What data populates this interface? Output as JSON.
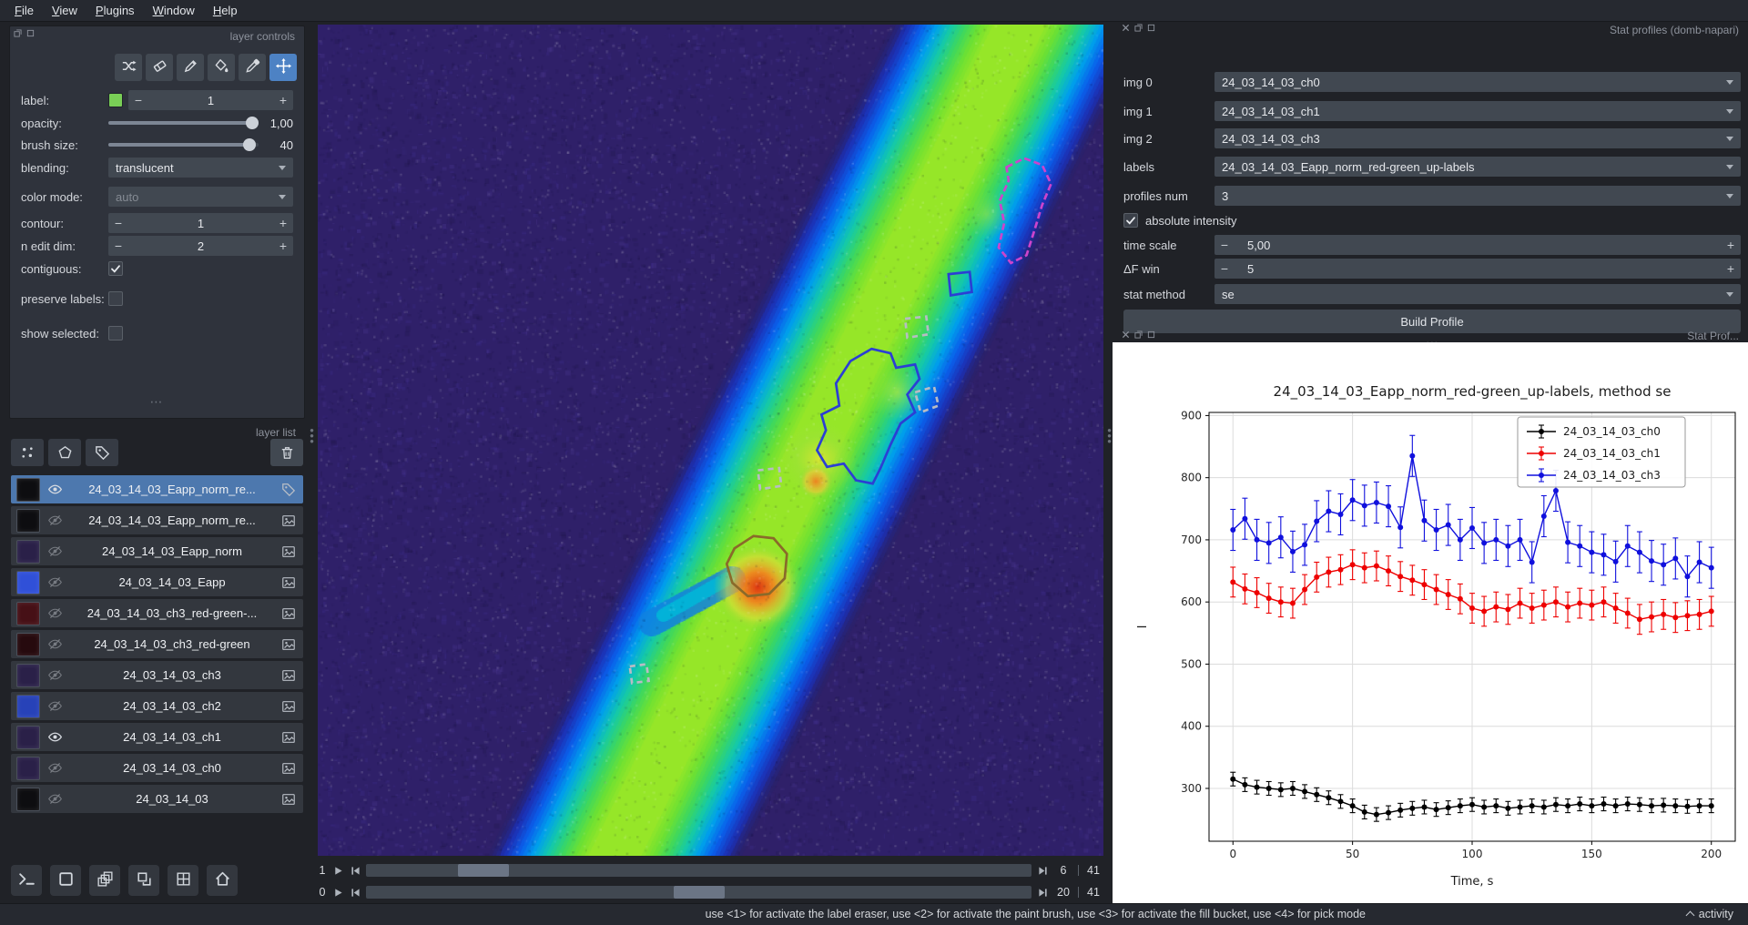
{
  "menu": {
    "items": [
      "File",
      "View",
      "Plugins",
      "Window",
      "Help"
    ]
  },
  "ui": {
    "minus": "−",
    "plus": "+",
    "dots": "⋯"
  },
  "layer_controls": {
    "title": "layer controls",
    "tools": [
      "shuffle-colors",
      "label-eraser",
      "paint-brush",
      "fill-bucket",
      "color-picker",
      "pan-zoom"
    ],
    "active_tool": "pan-zoom",
    "rows": {
      "label": {
        "label": "label:",
        "value": "1",
        "swatch_color": "#79cf56"
      },
      "opacity": {
        "label": "opacity:",
        "value": "1,00"
      },
      "brush_size": {
        "label": "brush size:",
        "value": "40"
      },
      "blending": {
        "label": "blending:",
        "value": "translucent"
      },
      "color_mode": {
        "label": "color mode:",
        "value": "auto",
        "disabled": true
      },
      "contour": {
        "label": "contour:",
        "value": "1"
      },
      "n_edit_dim": {
        "label": "n edit dim:",
        "value": "2"
      },
      "contiguous": {
        "label": "contiguous:",
        "checked": true
      },
      "preserve_labels": {
        "label": "preserve labels:",
        "checked": false
      },
      "show_selected": {
        "label": "show selected:",
        "checked": false
      }
    }
  },
  "layer_list": {
    "title": "layer list",
    "buttons": [
      "new-points-layer",
      "new-shapes-layer",
      "new-labels-layer"
    ],
    "delete_button": "delete-layer",
    "layers": [
      {
        "name": "24_03_14_03_Eapp_norm_re...",
        "visible": true,
        "selected": true,
        "type": "labels",
        "thumb": "#0d0d10"
      },
      {
        "name": "24_03_14_03_Eapp_norm_re...",
        "visible": false,
        "selected": false,
        "type": "image",
        "thumb": "#0d0d10"
      },
      {
        "name": "24_03_14_03_Eapp_norm",
        "visible": false,
        "selected": false,
        "type": "image",
        "thumb": "#2a2048"
      },
      {
        "name": "24_03_14_03_Eapp",
        "visible": false,
        "selected": false,
        "type": "image",
        "thumb": "#3050d8"
      },
      {
        "name": "24_03_14_03_ch3_red-green-...",
        "visible": false,
        "selected": false,
        "type": "image",
        "thumb": "#461016"
      },
      {
        "name": "24_03_14_03_ch3_red-green",
        "visible": false,
        "selected": false,
        "type": "image",
        "thumb": "#260a0e"
      },
      {
        "name": "24_03_14_03_ch3",
        "visible": false,
        "selected": false,
        "type": "image",
        "thumb": "#2a2048"
      },
      {
        "name": "24_03_14_03_ch2",
        "visible": false,
        "selected": false,
        "type": "image",
        "thumb": "#2742b8"
      },
      {
        "name": "24_03_14_03_ch1",
        "visible": true,
        "selected": false,
        "type": "image",
        "thumb": "#2a2048"
      },
      {
        "name": "24_03_14_03_ch0",
        "visible": false,
        "selected": false,
        "type": "image",
        "thumb": "#2a2048"
      },
      {
        "name": "24_03_14_03",
        "visible": false,
        "selected": false,
        "type": "image",
        "thumb": "#0d0d10"
      }
    ]
  },
  "viewer_buttons": [
    "console",
    "toggle-2d-3d",
    "roll-dimensions",
    "transpose-dimensions",
    "grid-view",
    "reset-view"
  ],
  "dims": [
    {
      "label": "1",
      "current": "6",
      "total": "41",
      "frac": 0.15
    },
    {
      "label": "0",
      "current": "20",
      "total": "41",
      "frac": 0.5
    }
  ],
  "stat_panel": {
    "title": "Stat profiles (domb-napari)",
    "img0": {
      "label": "img 0",
      "value": "24_03_14_03_ch0"
    },
    "img1": {
      "label": "img 1",
      "value": "24_03_14_03_ch1"
    },
    "img2": {
      "label": "img 2",
      "value": "24_03_14_03_ch3"
    },
    "labels": {
      "label": "labels",
      "value": "24_03_14_03_Eapp_norm_red-green_up-labels"
    },
    "profiles_num": {
      "label": "profiles num",
      "value": "3"
    },
    "absolute_intensity": {
      "label": "absolute intensity",
      "checked": true
    },
    "time_scale": {
      "label": "time scale",
      "value": "5,00"
    },
    "df_win": {
      "label": "ΔF win",
      "value": "5"
    },
    "stat_method": {
      "label": "stat method",
      "value": "se"
    },
    "build_button": "Build Profile"
  },
  "plot_panel": {
    "title": "Stat Prof..."
  },
  "chart_data": {
    "type": "line",
    "title": "24_03_14_03_Eapp_norm_red-green_up-labels, method se",
    "xlabel": "Time, s",
    "ylabel": "I",
    "xlim": [
      -10,
      210
    ],
    "ylim": [
      215,
      905
    ],
    "xticks": [
      0,
      50,
      100,
      150,
      200
    ],
    "yticks": [
      300,
      400,
      500,
      600,
      700,
      800,
      900
    ],
    "grid": true,
    "legend_position": "upper right",
    "x": [
      0,
      5,
      10,
      15,
      20,
      25,
      30,
      35,
      40,
      45,
      50,
      55,
      60,
      65,
      70,
      75,
      80,
      85,
      90,
      95,
      100,
      105,
      110,
      115,
      120,
      125,
      130,
      135,
      140,
      145,
      150,
      155,
      160,
      165,
      170,
      175,
      180,
      185,
      190,
      195,
      200
    ],
    "series": [
      {
        "name": "24_03_14_03_ch0",
        "color": "#000000",
        "yerr": 11,
        "values": [
          315,
          306,
          302,
          300,
          298,
          300,
          295,
          290,
          285,
          279,
          272,
          262,
          258,
          261,
          265,
          268,
          270,
          266,
          269,
          272,
          274,
          270,
          272,
          268,
          270,
          272,
          270,
          274,
          272,
          275,
          272,
          275,
          272,
          275,
          274,
          272,
          273,
          272,
          271,
          272,
          272
        ]
      },
      {
        "name": "24_03_14_03_ch1",
        "color": "#ee0000",
        "yerr": 24,
        "values": [
          632,
          621,
          615,
          606,
          600,
          598,
          620,
          640,
          648,
          652,
          660,
          655,
          658,
          650,
          641,
          635,
          628,
          620,
          612,
          605,
          590,
          585,
          592,
          588,
          598,
          590,
          595,
          600,
          592,
          598,
          595,
          600,
          590,
          582,
          572,
          576,
          580,
          575,
          578,
          580,
          585
        ]
      },
      {
        "name": "24_03_14_03_ch3",
        "color": "#1010dd",
        "yerr": 33,
        "values": [
          716,
          734,
          700,
          695,
          704,
          681,
          692,
          730,
          746,
          741,
          764,
          755,
          760,
          754,
          720,
          835,
          731,
          716,
          724,
          700,
          719,
          695,
          700,
          690,
          700,
          664,
          738,
          779,
          696,
          690,
          680,
          676,
          665,
          690,
          680,
          666,
          660,
          670,
          641,
          664,
          655
        ]
      }
    ]
  },
  "rois": [
    {
      "color": "#cc44cc",
      "dash": "6,3",
      "points": [
        [
          618,
          128
        ],
        [
          634,
          120
        ],
        [
          650,
          126
        ],
        [
          658,
          143
        ],
        [
          650,
          162
        ],
        [
          643,
          185
        ],
        [
          636,
          207
        ],
        [
          622,
          214
        ],
        [
          611,
          200
        ],
        [
          616,
          178
        ],
        [
          612,
          158
        ],
        [
          620,
          140
        ]
      ]
    },
    {
      "color": "#2b3fd4",
      "dash": "",
      "points": [
        [
          566,
          224
        ],
        [
          585,
          222
        ],
        [
          587,
          240
        ],
        [
          568,
          243
        ]
      ]
    },
    {
      "color": "#b8bcc4",
      "dash": "5,4",
      "points": [
        [
          527,
          264
        ],
        [
          546,
          262
        ],
        [
          548,
          278
        ],
        [
          529,
          281
        ]
      ]
    },
    {
      "color": "#2b3fd4",
      "dash": "",
      "points": [
        [
          452,
          350
        ],
        [
          468,
          342
        ],
        [
          465,
          322
        ],
        [
          478,
          302
        ],
        [
          497,
          291
        ],
        [
          514,
          295
        ],
        [
          519,
          308
        ],
        [
          536,
          305
        ],
        [
          540,
          318
        ],
        [
          529,
          332
        ],
        [
          536,
          348
        ],
        [
          523,
          358
        ],
        [
          514,
          377
        ],
        [
          505,
          398
        ],
        [
          498,
          412
        ],
        [
          483,
          409
        ],
        [
          472,
          394
        ],
        [
          457,
          397
        ],
        [
          448,
          382
        ],
        [
          456,
          364
        ]
      ]
    },
    {
      "color": "#b8bcc4",
      "dash": "5,4",
      "points": [
        [
          536,
          330
        ],
        [
          553,
          325
        ],
        [
          557,
          342
        ],
        [
          541,
          348
        ]
      ]
    },
    {
      "color": "#b8bcc4",
      "dash": "5,4",
      "points": [
        [
          395,
          400
        ],
        [
          414,
          398
        ],
        [
          416,
          414
        ],
        [
          397,
          417
        ]
      ]
    },
    {
      "color": "#8a6a2a",
      "dash": "",
      "points": [
        [
          374,
          470
        ],
        [
          391,
          459
        ],
        [
          409,
          461
        ],
        [
          421,
          475
        ],
        [
          419,
          497
        ],
        [
          405,
          511
        ],
        [
          386,
          513
        ],
        [
          372,
          501
        ],
        [
          367,
          484
        ]
      ]
    },
    {
      "color": "#b8bcc4",
      "dash": "5,4",
      "points": [
        [
          280,
          576
        ],
        [
          295,
          574
        ],
        [
          297,
          589
        ],
        [
          282,
          591
        ]
      ]
    }
  ],
  "status_bar": {
    "hint": "use <1> for activate the label eraser, use <2> for activate the paint brush, use <3> for activate the fill bucket, use <4> for pick mode",
    "activity": "activity"
  }
}
